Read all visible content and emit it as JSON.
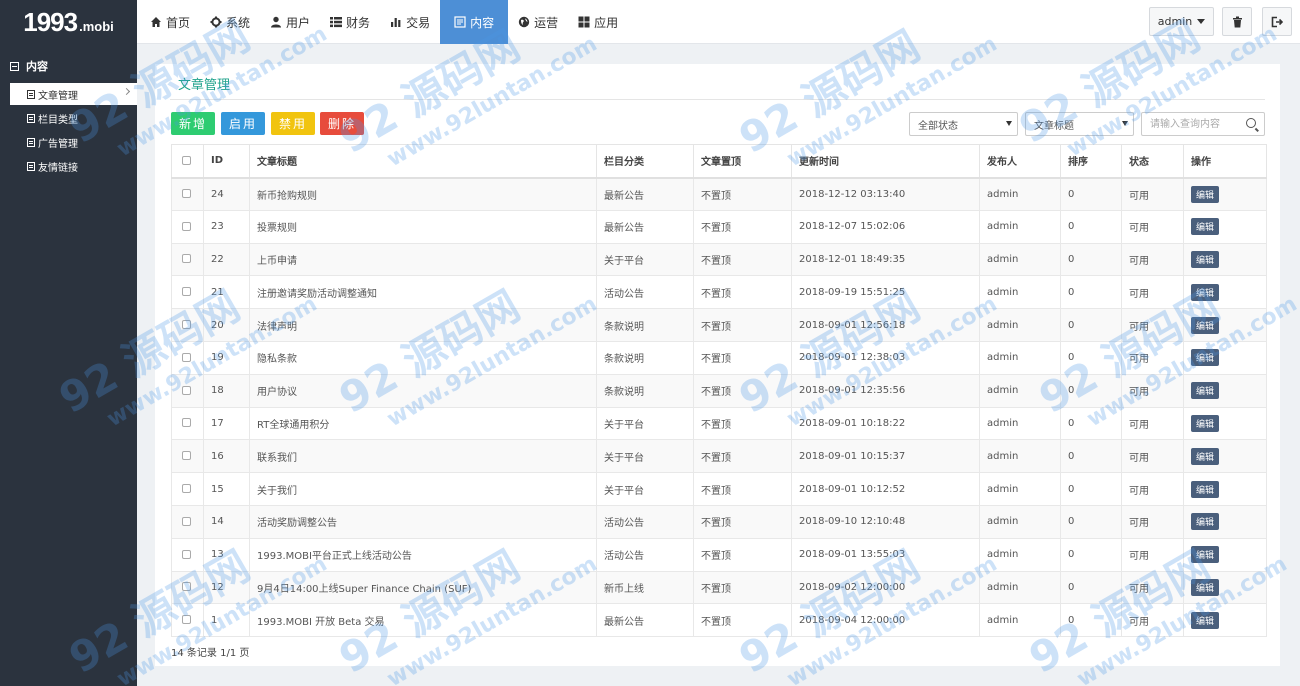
{
  "logo": {
    "main": "1993",
    "suffix": ".mobi"
  },
  "nav": [
    {
      "label": "首页",
      "icon": "home-icon"
    },
    {
      "label": "系统",
      "icon": "gear-icon"
    },
    {
      "label": "用户",
      "icon": "user-icon"
    },
    {
      "label": "财务",
      "icon": "list-icon"
    },
    {
      "label": "交易",
      "icon": "bar-chart-icon"
    },
    {
      "label": "内容",
      "icon": "document-icon",
      "active": true
    },
    {
      "label": "运营",
      "icon": "globe-icon"
    },
    {
      "label": "应用",
      "icon": "grid-icon"
    }
  ],
  "user": {
    "name": "admin"
  },
  "sidebar": {
    "section": "内容",
    "items": [
      {
        "label": "文章管理",
        "active": true
      },
      {
        "label": "栏目类型"
      },
      {
        "label": "广告管理"
      },
      {
        "label": "友情链接"
      }
    ]
  },
  "panel": {
    "title": "文章管理"
  },
  "toolbar": {
    "add": "新增",
    "enable": "启用",
    "disable": "禁用",
    "delete": "删除",
    "status_select": "全部状态",
    "field_select": "文章标题",
    "search_placeholder": "请输入查询内容"
  },
  "table": {
    "headers": [
      "",
      "ID",
      "文章标题",
      "栏目分类",
      "文章置顶",
      "更新时间",
      "发布人",
      "排序",
      "状态",
      "操作"
    ],
    "edit_label": "编辑",
    "rows": [
      [
        "24",
        "新币抢购规则",
        "最新公告",
        "不置顶",
        "2018-12-12 03:13:40",
        "admin",
        "0",
        "可用"
      ],
      [
        "23",
        "投票规则",
        "最新公告",
        "不置顶",
        "2018-12-07 15:02:06",
        "admin",
        "0",
        "可用"
      ],
      [
        "22",
        "上币申请",
        "关于平台",
        "不置顶",
        "2018-12-01 18:49:35",
        "admin",
        "0",
        "可用"
      ],
      [
        "21",
        "注册邀请奖励活动调整通知",
        "活动公告",
        "不置顶",
        "2018-09-19 15:51:25",
        "admin",
        "0",
        "可用"
      ],
      [
        "20",
        "法律声明",
        "条款说明",
        "不置顶",
        "2018-09-01 12:56:18",
        "admin",
        "0",
        "可用"
      ],
      [
        "19",
        "隐私条款",
        "条款说明",
        "不置顶",
        "2018-09-01 12:38:03",
        "admin",
        "0",
        "可用"
      ],
      [
        "18",
        "用户协议",
        "条款说明",
        "不置顶",
        "2018-09-01 12:35:56",
        "admin",
        "0",
        "可用"
      ],
      [
        "17",
        "RT全球通用积分",
        "关于平台",
        "不置顶",
        "2018-09-01 10:18:22",
        "admin",
        "0",
        "可用"
      ],
      [
        "16",
        "联系我们",
        "关于平台",
        "不置顶",
        "2018-09-01 10:15:37",
        "admin",
        "0",
        "可用"
      ],
      [
        "15",
        "关于我们",
        "关于平台",
        "不置顶",
        "2018-09-01 10:12:52",
        "admin",
        "0",
        "可用"
      ],
      [
        "14",
        "活动奖励调整公告",
        "活动公告",
        "不置顶",
        "2018-09-10 12:10:48",
        "admin",
        "0",
        "可用"
      ],
      [
        "13",
        "1993.MOBI平台正式上线活动公告",
        "活动公告",
        "不置顶",
        "2018-09-01 13:55:03",
        "admin",
        "0",
        "可用"
      ],
      [
        "12",
        "9月4日14:00上线Super Finance Chain (SUF)",
        "新币上线",
        "不置顶",
        "2018-09-02 12:00:00",
        "admin",
        "0",
        "可用"
      ],
      [
        "1",
        "1993.MOBI 开放 Beta 交易",
        "最新公告",
        "不置顶",
        "2018-09-04 12:00:00",
        "admin",
        "0",
        "可用"
      ]
    ]
  },
  "footer": {
    "summary": "14 条记录 1/1 页"
  },
  "watermark": {
    "main": "92 源码网",
    "url": "www.92luntan.com"
  },
  "colors": {
    "accent": "#4d8fd6",
    "title": "#1ea28b",
    "sidebar": "#2b333e",
    "add": "#2ecc71",
    "enable": "#3498db",
    "disable": "#f1c40f",
    "delete": "#e74c3c",
    "edit": "#4a5f7c"
  }
}
